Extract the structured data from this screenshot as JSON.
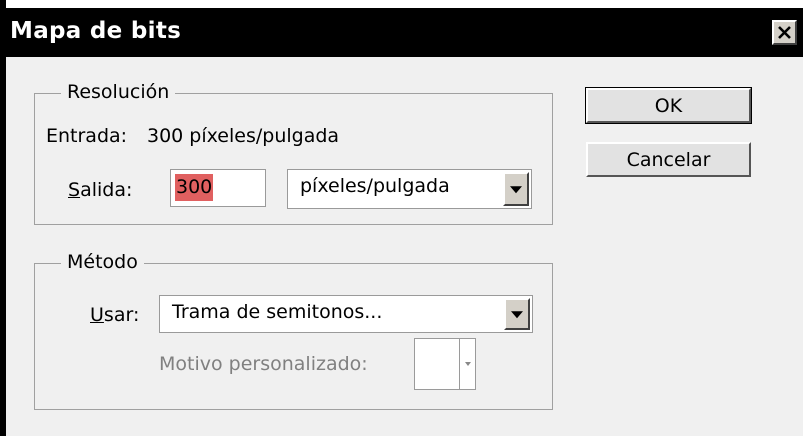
{
  "window": {
    "title": "Mapa de bits"
  },
  "resolution": {
    "legend": "Resolución",
    "input_label": "Entrada:",
    "input_value": "300 píxeles/pulgada",
    "output_label_accel": "S",
    "output_label_rest": "alida:",
    "output_value": "300",
    "output_unit": "píxeles/pulgada"
  },
  "method": {
    "legend": "Método",
    "use_label_accel": "U",
    "use_label_rest": "sar:",
    "use_value": "Trama de semitonos...",
    "custom_pattern_label": "Motivo personalizado:"
  },
  "buttons": {
    "ok": "OK",
    "cancel": "Cancelar"
  }
}
